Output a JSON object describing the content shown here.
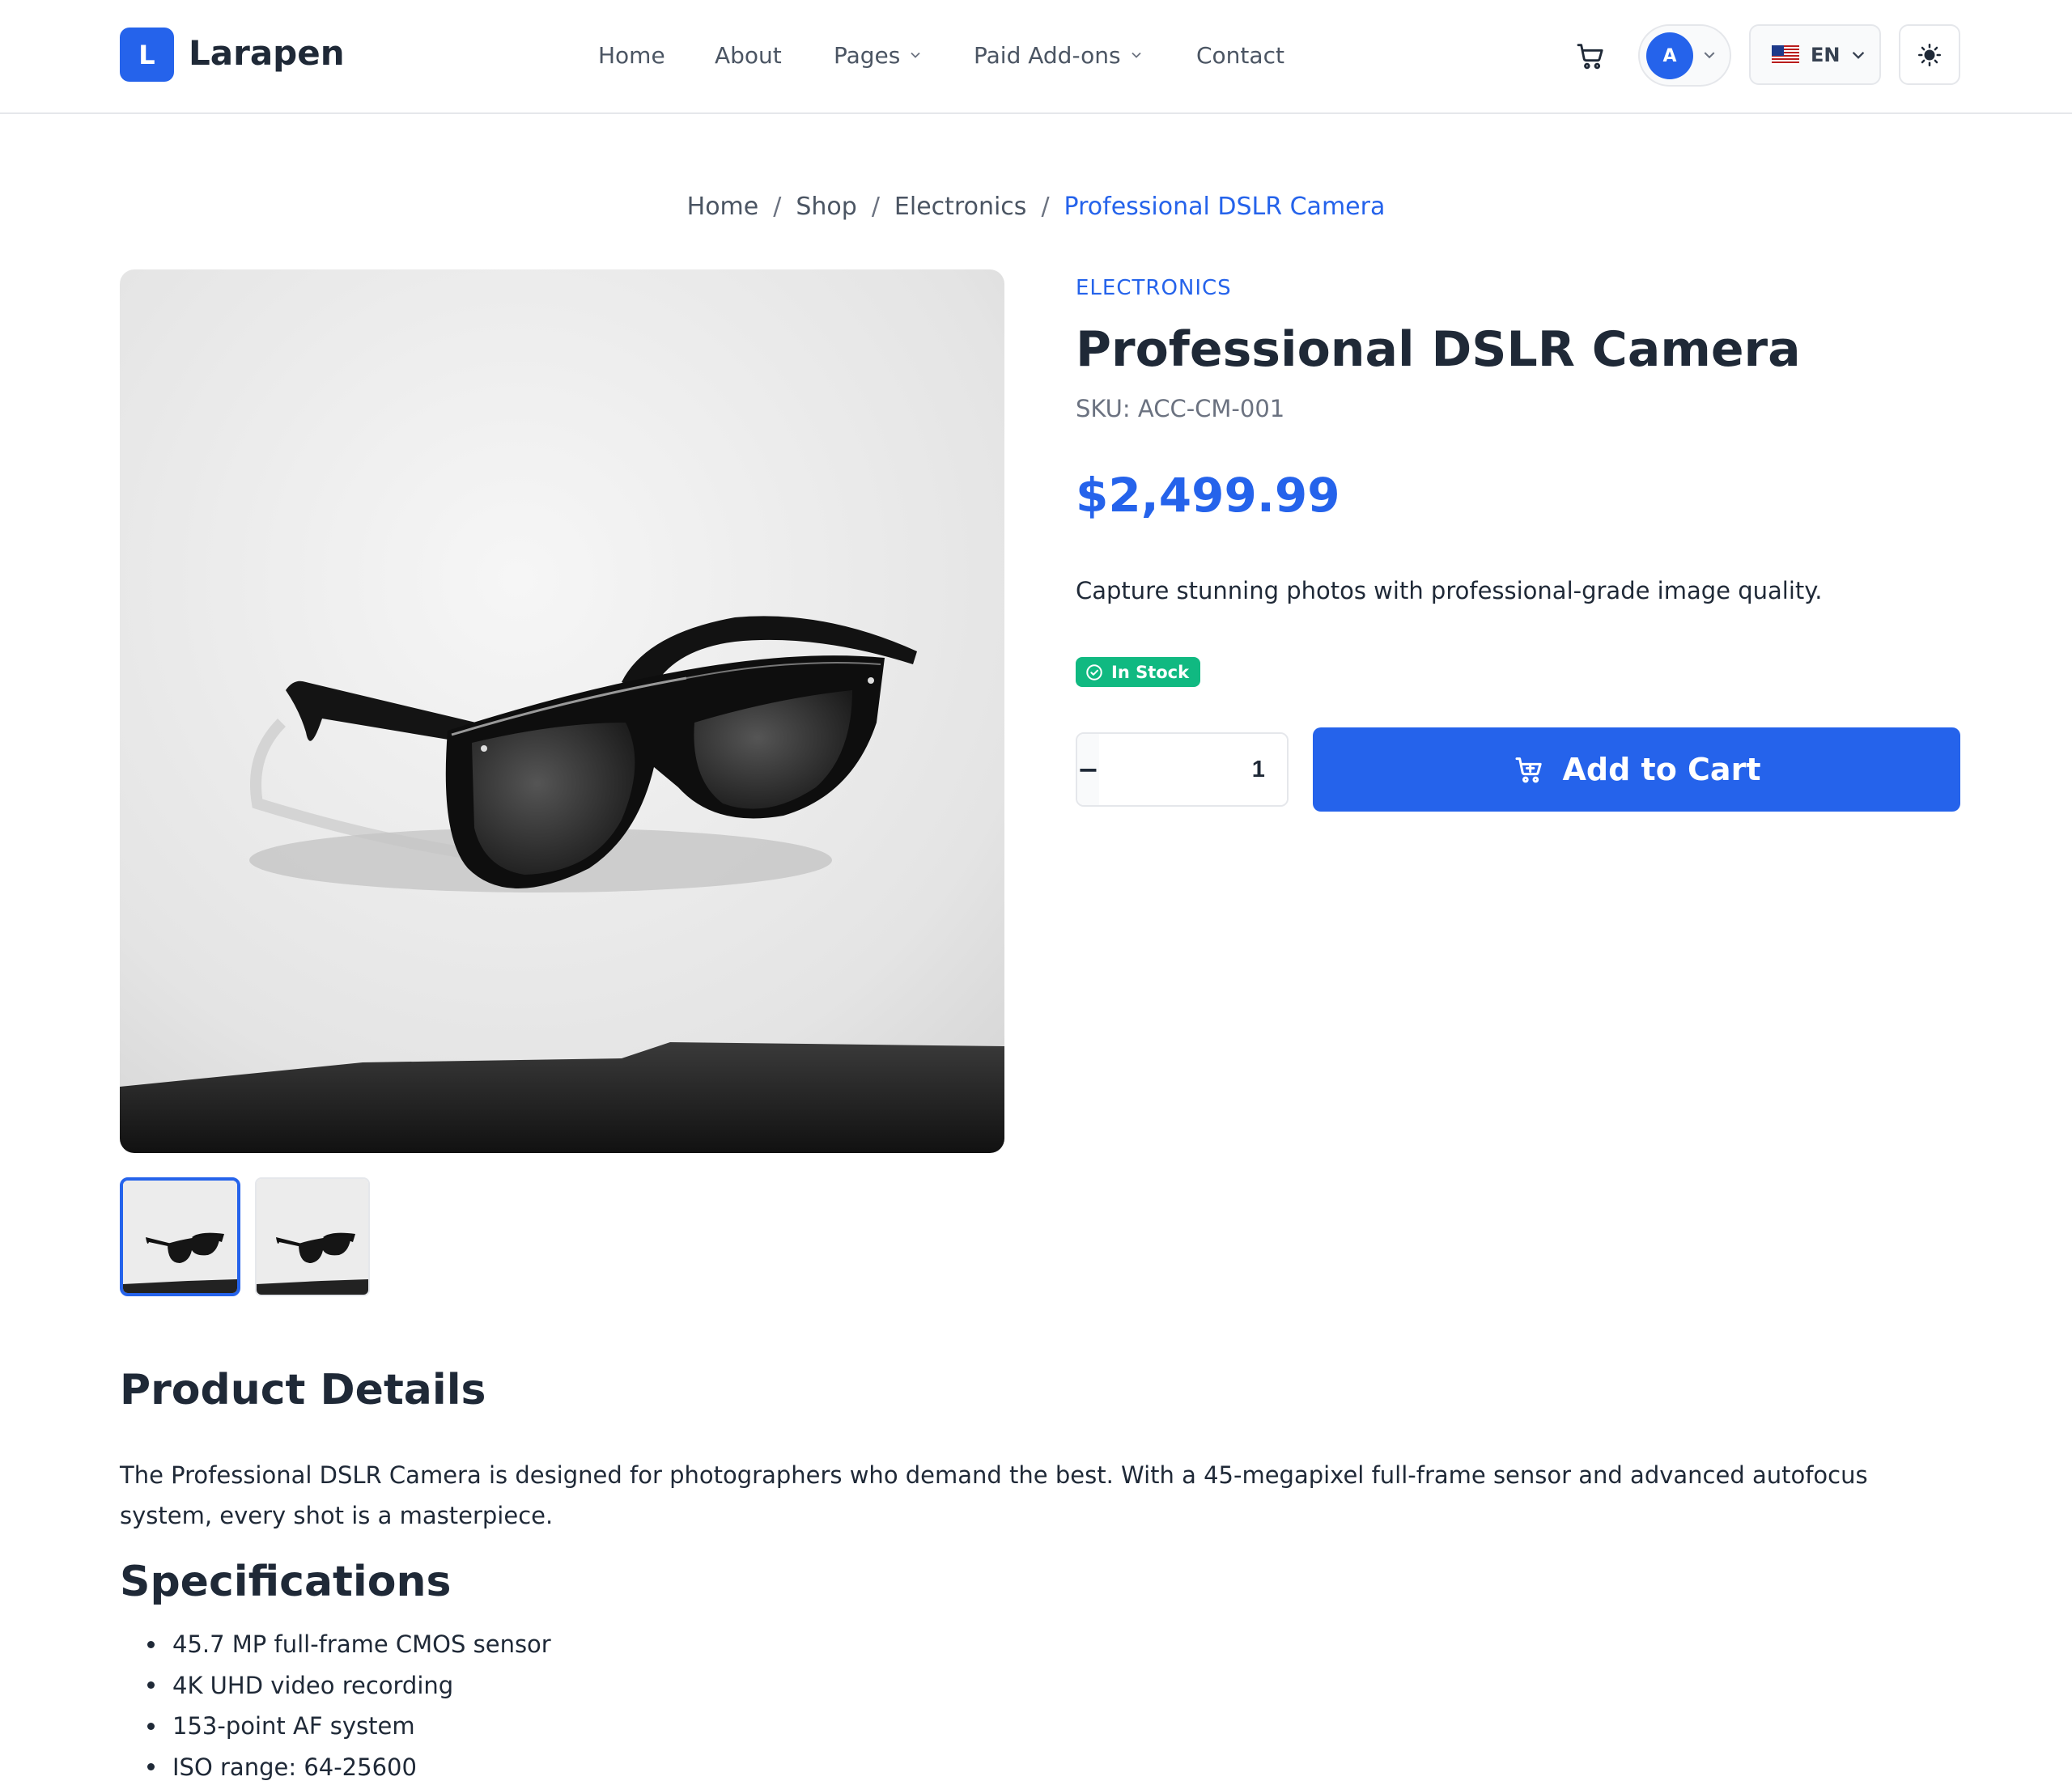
{
  "header": {
    "logo_letter": "L",
    "brand": "Larapen",
    "nav": [
      {
        "label": "Home"
      },
      {
        "label": "About"
      },
      {
        "label": "Pages"
      },
      {
        "label": "Paid Add-ons"
      },
      {
        "label": "Contact"
      }
    ],
    "avatar_initial": "A",
    "language": "EN"
  },
  "breadcrumb": [
    "Home",
    "Shop",
    "Electronics",
    "Professional DSLR Camera"
  ],
  "product": {
    "category": "ELECTRONICS",
    "title": "Professional DSLR Camera",
    "sku": "SKU: ACC-CM-001",
    "price": "$2,499.99",
    "short_description": "Capture stunning photos with professional-grade image quality.",
    "stock_label": "In Stock",
    "quantity": "1",
    "qty_minus": "−",
    "qty_plus": "+",
    "add_to_cart": "Add to Cart"
  },
  "details": {
    "heading": "Product Details",
    "text": "The Professional DSLR Camera is designed for photographers who demand the best. With a 45-megapixel full-frame sensor and advanced autofocus system, every shot is a masterpiece.",
    "spec_heading": "Specifications",
    "specs": [
      "45.7 MP full-frame CMOS sensor",
      "4K UHD video recording",
      "153-point AF system",
      "ISO range: 64-25600"
    ]
  },
  "colors": {
    "accent": "#2563eb",
    "success": "#10b981",
    "text": "#1f2937",
    "muted": "#6b7280"
  },
  "icons": [
    "cart-icon",
    "chevron-down-icon",
    "us-flag-icon",
    "sun-icon",
    "check-circle-icon",
    "cart-plus-icon"
  ]
}
